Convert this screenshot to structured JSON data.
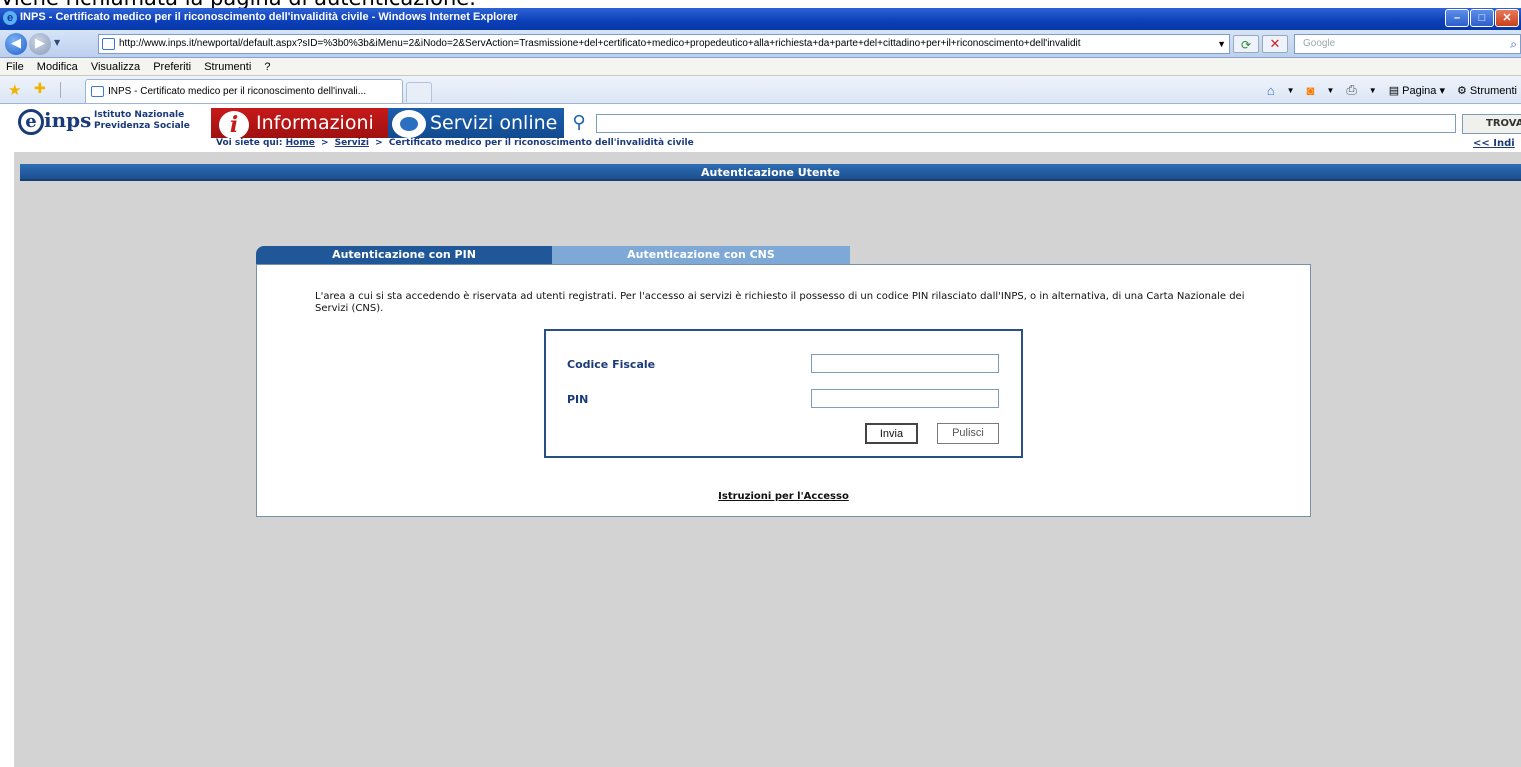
{
  "caption": "Viene richiamata la pagina di autenticazione.",
  "window": {
    "title": "INPS - Certificato medico per il riconoscimento dell'invalidità civile - Windows Internet Explorer",
    "buttons": [
      "–",
      "□",
      "✕"
    ]
  },
  "address_bar": {
    "url": "http://www.inps.it/newportal/default.aspx?sID=%3b0%3b&iMenu=2&iNodo=2&ServAction=Trasmissione+del+certificato+medico+propedeutico+alla+richiesta+da+parte+del+cittadino+per+il+riconoscimento+dell'invalidit",
    "search_placeholder": "Google"
  },
  "menu": [
    "File",
    "Modifica",
    "Visualizza",
    "Preferiti",
    "Strumenti",
    "?"
  ],
  "tab": {
    "label": "INPS - Certificato medico per il riconoscimento dell'invali..."
  },
  "command_bar": {
    "page_label": "Pagina",
    "tools_label": "Strumenti"
  },
  "site": {
    "logo_text": "inps",
    "logo_sub": "Istituto Nazionale\nPrevidenza Sociale",
    "nav_info": "Informazioni",
    "nav_services": "Servizi online",
    "search_button": "TROVA",
    "breadcrumb": {
      "prefix": "Voi siete qui:",
      "home": "Home",
      "servizi": "Servizi",
      "current": "Certificato medico per il riconoscimento dell'invalidità civile"
    },
    "index_link": "<< Indi"
  },
  "auth": {
    "header": "Autenticazione Utente",
    "tab_pin": "Autenticazione con PIN",
    "tab_cns": "Autenticazione con CNS",
    "intro": "L'area a cui si sta accedendo è riservata ad utenti registrati. Per l'accesso ai servizi è richiesto il possesso di un codice PIN rilasciato dall'INPS, o in alternativa, di una Carta Nazionale dei Servizi (CNS).",
    "codice_fiscale_label": "Codice Fiscale",
    "codice_fiscale_value": "",
    "pin_label": "PIN",
    "pin_value": "",
    "submit_label": "Invia",
    "clear_label": "Pulisci",
    "instructions_link": "Istruzioni per l'Accesso"
  }
}
